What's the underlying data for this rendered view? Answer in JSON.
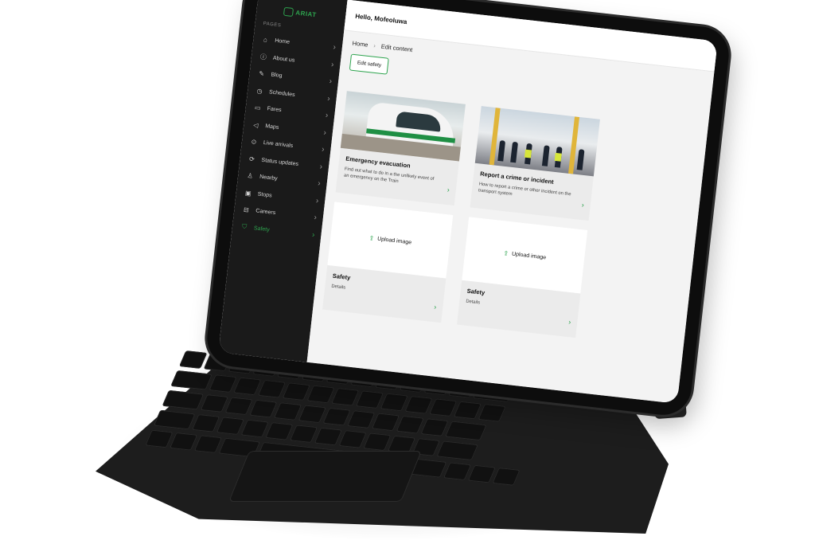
{
  "app": {
    "logo_text": "ARIAT",
    "greeting": "Hello, Mofeoluwa"
  },
  "sidebar": {
    "section_label": "PAGES",
    "items": [
      {
        "label": "Home",
        "icon": "home-icon",
        "glyph": "⌂"
      },
      {
        "label": "About us",
        "icon": "info-icon",
        "glyph": "ⓘ"
      },
      {
        "label": "Blog",
        "icon": "edit-icon",
        "glyph": "✎"
      },
      {
        "label": "Schedules",
        "icon": "clock-icon",
        "glyph": "◷"
      },
      {
        "label": "Fares",
        "icon": "ticket-icon",
        "glyph": "▭"
      },
      {
        "label": "Maps",
        "icon": "navigation-icon",
        "glyph": "◁"
      },
      {
        "label": "Live arrivals",
        "icon": "live-icon",
        "glyph": "⊙"
      },
      {
        "label": "Status updates",
        "icon": "refresh-icon",
        "glyph": "⟳"
      },
      {
        "label": "Nearby",
        "icon": "person-pin-icon",
        "glyph": "♙"
      },
      {
        "label": "Stops",
        "icon": "bus-icon",
        "glyph": "▣"
      },
      {
        "label": "Careers",
        "icon": "briefcase-icon",
        "glyph": "⊟"
      },
      {
        "label": "Safety",
        "icon": "shield-icon",
        "glyph": "⛉",
        "active": true
      }
    ]
  },
  "breadcrumb": {
    "home": "Home",
    "separator": "›",
    "current": "Edit content"
  },
  "edit_button": "Edit safety",
  "cards": [
    {
      "title": "Emergency evacuation",
      "desc": "Find out what to do in a the unlikely event of an emergency on the Train",
      "image": "train-photo"
    },
    {
      "title": "Report a crime or incident",
      "desc": "How to report a crime or other incident on the transport system",
      "image": "station-photo"
    },
    {
      "title": "Safety",
      "desc": "Details",
      "upload_label": "Upload image"
    },
    {
      "title": "Safety",
      "desc": "Details",
      "upload_label": "Upload image"
    }
  ],
  "colors": {
    "accent": "#2ea44f",
    "sidebar_bg": "#1a1a1a",
    "content_bg": "#f3f3f3"
  }
}
